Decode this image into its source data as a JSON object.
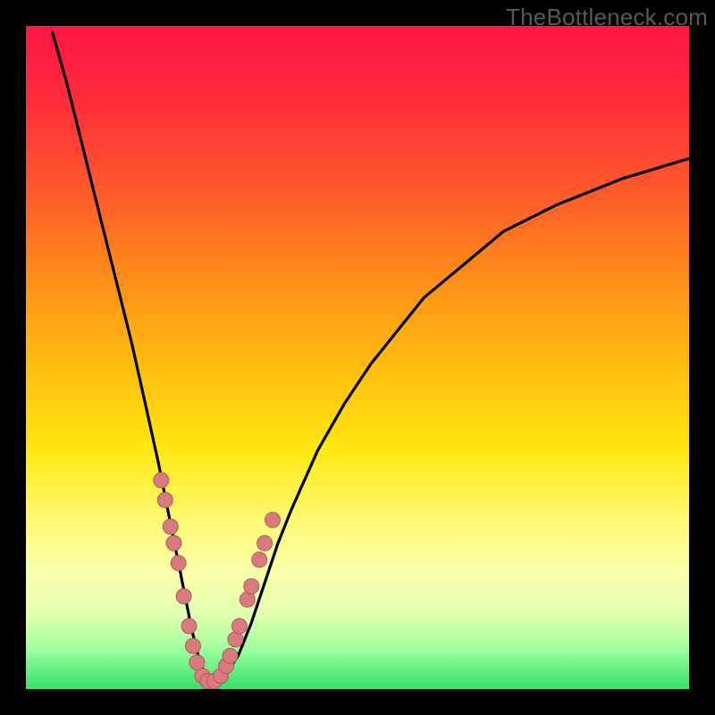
{
  "attribution": "TheBottleneck.com",
  "colors": {
    "frame": "#000000",
    "curve": "#000000",
    "marker_fill": "#d97a7f",
    "marker_stroke": "#b05a5f",
    "gradient_top": "#ff1544",
    "gradient_bottom": "#35e06a"
  },
  "chart_data": {
    "type": "line",
    "title": "",
    "xlabel": "",
    "ylabel": "",
    "xlim": [
      0,
      100
    ],
    "ylim": [
      0,
      100
    ],
    "grid": false,
    "legend": false,
    "series": [
      {
        "name": "curve",
        "x": [
          4,
          6,
          8,
          10,
          12,
          14,
          16,
          18,
          20,
          22,
          23,
          24,
          25,
          26,
          27,
          28,
          29,
          30,
          32,
          34,
          36,
          38,
          40,
          44,
          48,
          52,
          56,
          60,
          66,
          72,
          80,
          90,
          100
        ],
        "y": [
          99,
          92,
          84,
          76,
          68,
          60,
          52,
          43,
          34,
          24,
          19,
          14,
          9,
          5,
          2,
          1,
          1,
          2,
          5,
          10,
          16,
          22,
          27,
          36,
          43,
          49,
          54,
          59,
          64,
          69,
          73,
          77,
          80
        ]
      }
    ],
    "markers": {
      "name": "highlighted-points",
      "x": [
        20.4,
        21.0,
        21.8,
        22.3,
        23.0,
        23.8,
        24.6,
        25.2,
        25.8,
        26.6,
        27.4,
        28.4,
        29.4,
        30.2,
        30.8,
        31.6,
        32.2,
        33.4,
        34.0,
        35.2,
        36.0,
        37.2
      ],
      "y": [
        31.5,
        28.5,
        24.5,
        22.0,
        19.0,
        14.0,
        9.5,
        6.5,
        4.0,
        2.0,
        1.2,
        1.2,
        2.0,
        3.5,
        5.0,
        7.5,
        9.5,
        13.5,
        15.5,
        19.5,
        22.0,
        25.5
      ]
    }
  }
}
